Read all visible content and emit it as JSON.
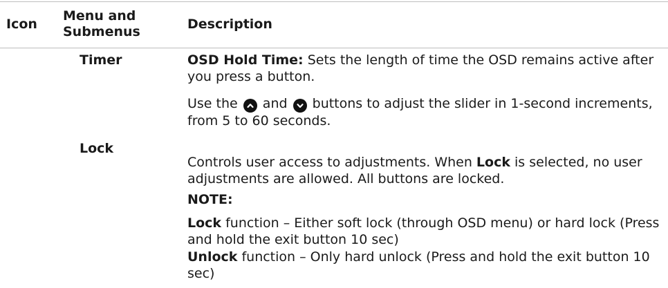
{
  "header": {
    "icon": "Icon",
    "menu_line1": "Menu and",
    "menu_line2": "Submenus",
    "description": "Description"
  },
  "timer": {
    "label": "Timer",
    "hold_title": "OSD Hold Time:",
    "hold_text": " Sets the length of time the OSD remains active after you press a button.",
    "use_prefix": "Use the ",
    "up_icon": "chevron-up-icon",
    "use_and": " and ",
    "down_icon": "chevron-down-icon",
    "use_suffix": " buttons to adjust the slider in 1-second increments, from 5 to 60 seconds."
  },
  "lock": {
    "label": "Lock",
    "line1_a": "Controls user access to adjustments. When ",
    "line1_bold": "Lock",
    "line1_b": " is selected, no user adjustments are allowed. All buttons are locked.",
    "note_label": "NOTE:",
    "lock_bold": "Lock",
    "lock_text": " function – Either soft lock (through OSD menu) or hard lock (Press and hold the exit button 10 sec)",
    "unlock_bold": "Unlock",
    "unlock_text": " function – Only hard unlock (Press and hold the exit button 10 sec)"
  }
}
